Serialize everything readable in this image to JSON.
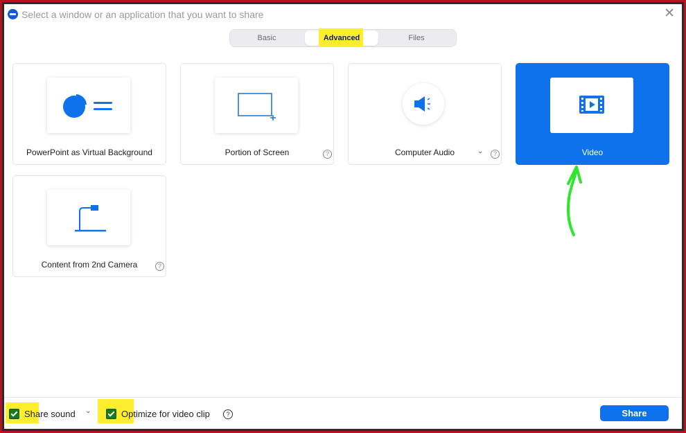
{
  "window": {
    "title": "Select a window or an application that you want to share",
    "app_icon": "zoom-logo-icon",
    "close_glyph": "✕"
  },
  "tabs": [
    {
      "label": "Basic",
      "active": false
    },
    {
      "label": "Advanced",
      "active": true
    },
    {
      "label": "Files",
      "active": false
    }
  ],
  "cards": [
    {
      "label": "PowerPoint as Virtual Background",
      "icon": "pie-chart-lines-icon",
      "selected": false
    },
    {
      "label": "Portion of Screen",
      "icon": "screen-portion-icon",
      "selected": false,
      "help": true
    },
    {
      "label": "Computer Audio",
      "icon": "speaker-icon",
      "selected": false,
      "help": true,
      "dropdown": true
    },
    {
      "label": "Video",
      "icon": "film-play-icon",
      "selected": true
    },
    {
      "label": "Content from 2nd Camera",
      "icon": "document-camera-icon",
      "selected": false,
      "help": true
    }
  ],
  "footer": {
    "share_sound": {
      "label": "Share sound",
      "checked": true
    },
    "optimize_video": {
      "label": "Optimize for video clip",
      "checked": true
    },
    "share_button": "Share",
    "help_glyph": "?",
    "dropdown_glyph": "⌄"
  },
  "colors": {
    "accent": "#0e72ed",
    "highlight": "#ffee2e",
    "annotation_arrow": "#2ee62e",
    "frame": "#b0161f"
  }
}
